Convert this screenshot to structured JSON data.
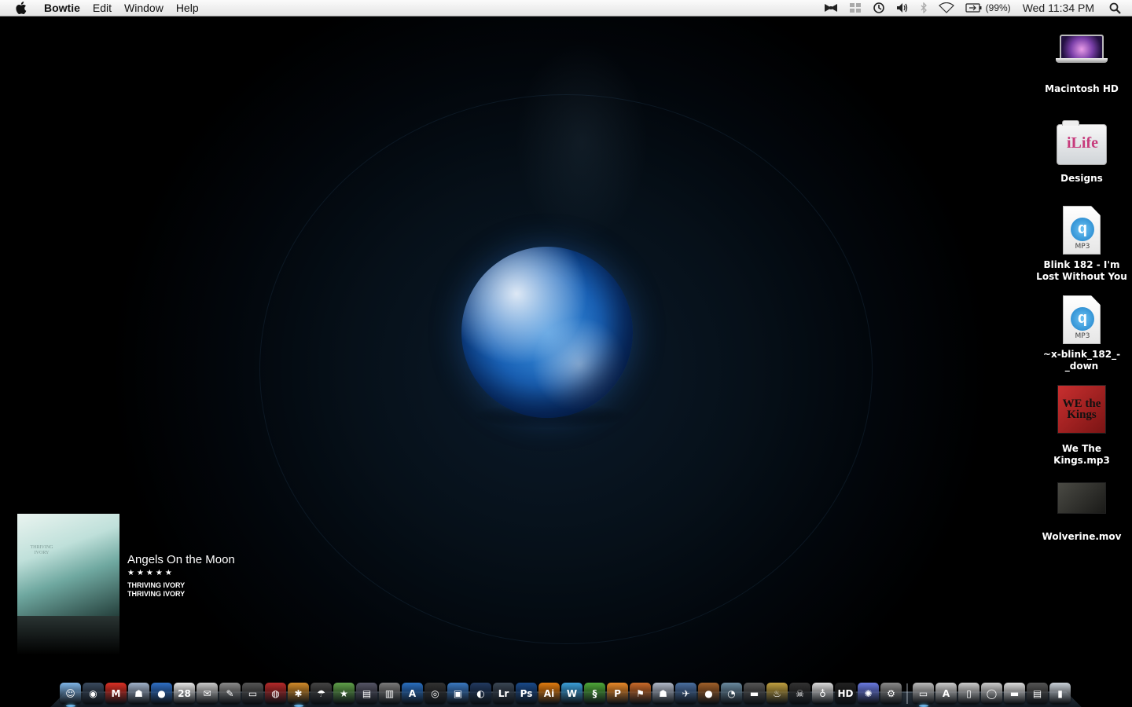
{
  "menubar": {
    "app_name": "Bowtie",
    "menus": [
      "Edit",
      "Window",
      "Help"
    ],
    "battery_percent": "(99%)",
    "clock": "Wed 11:34 PM"
  },
  "desktop_icons": [
    {
      "label": "Macintosh HD",
      "kind": "hard-drive"
    },
    {
      "label": "Designs",
      "kind": "folder",
      "badge": "iLife"
    },
    {
      "label": "Blink 182 - I'm Lost Without You",
      "kind": "mp3",
      "type_label": "MP3"
    },
    {
      "label": "~x-blink_182_-_down",
      "kind": "mp3",
      "type_label": "MP3"
    },
    {
      "label": "We The Kings.mp3",
      "kind": "album-art",
      "art_text": "WE the Kings"
    },
    {
      "label": "Wolverine.mov",
      "kind": "movie"
    }
  ],
  "now_playing": {
    "title": "Angels On the Moon",
    "rating_stars": "★★★★★",
    "artist": "THRIVING IVORY",
    "album": "THRIVING IVORY",
    "cover_text": "THRIVING IVORY"
  },
  "dock": {
    "apps": [
      {
        "name": "finder",
        "glyph": "☺",
        "color": "#7fb4e6"
      },
      {
        "name": "dashboard",
        "glyph": "◉",
        "color": "#3a4a5e"
      },
      {
        "name": "gmail",
        "glyph": "M",
        "color": "#d93025"
      },
      {
        "name": "robot",
        "glyph": "☗",
        "color": "#9fb0c8"
      },
      {
        "name": "firefox",
        "glyph": "●",
        "color": "#2f6fc4"
      },
      {
        "name": "ical",
        "glyph": "28",
        "color": "#e8e8e8"
      },
      {
        "name": "mail",
        "glyph": "✉",
        "color": "#c9c9c9"
      },
      {
        "name": "textedit",
        "glyph": "✎",
        "color": "#8a8a8a"
      },
      {
        "name": "display",
        "glyph": "▭",
        "color": "#555"
      },
      {
        "name": "record",
        "glyph": "◍",
        "color": "#b52a2a"
      },
      {
        "name": "clapper",
        "glyph": "✱",
        "color": "#d08a2a"
      },
      {
        "name": "umbrella",
        "glyph": "☂",
        "color": "#444"
      },
      {
        "name": "imovie",
        "glyph": "★",
        "color": "#5fa04a"
      },
      {
        "name": "film",
        "glyph": "▤",
        "color": "#556"
      },
      {
        "name": "books",
        "glyph": "▥",
        "color": "#7a7a7a"
      },
      {
        "name": "appstore",
        "glyph": "A",
        "color": "#2a6fc0"
      },
      {
        "name": "camera",
        "glyph": "◎",
        "color": "#333"
      },
      {
        "name": "preview",
        "glyph": "▣",
        "color": "#3a78c0"
      },
      {
        "name": "music",
        "glyph": "◐",
        "color": "#223a60"
      },
      {
        "name": "lightroom",
        "glyph": "Lr",
        "color": "#3a4654"
      },
      {
        "name": "photoshop",
        "glyph": "Ps",
        "color": "#1a4a8a"
      },
      {
        "name": "illustrator",
        "glyph": "Ai",
        "color": "#e07b10"
      },
      {
        "name": "wave",
        "glyph": "W",
        "color": "#3b9ed8"
      },
      {
        "name": "lizard",
        "glyph": "§",
        "color": "#4ea83a"
      },
      {
        "name": "paw",
        "glyph": "P",
        "color": "#e8892a"
      },
      {
        "name": "sign",
        "glyph": "⚑",
        "color": "#c86a2a"
      },
      {
        "name": "trooper",
        "glyph": "☗",
        "color": "#b0b8c8"
      },
      {
        "name": "plane",
        "glyph": "✈",
        "color": "#4a6fa0"
      },
      {
        "name": "coconut",
        "glyph": "●",
        "color": "#a0602a"
      },
      {
        "name": "time",
        "glyph": "◔",
        "color": "#6a8aa0"
      },
      {
        "name": "gun",
        "glyph": "▬",
        "color": "#555"
      },
      {
        "name": "fire",
        "glyph": "♨",
        "color": "#c0a040"
      },
      {
        "name": "pirate",
        "glyph": "☠",
        "color": "#333"
      },
      {
        "name": "bulb",
        "glyph": "♁",
        "color": "#ddd"
      },
      {
        "name": "hd",
        "glyph": "HD",
        "color": "#222"
      },
      {
        "name": "burst",
        "glyph": "✺",
        "color": "#6a7ae0"
      },
      {
        "name": "settings",
        "glyph": "⚙",
        "color": "#8a8a8a"
      }
    ],
    "stacks": [
      {
        "name": "stack-drive",
        "glyph": "▭",
        "color": "#bbb"
      },
      {
        "name": "stack-apps",
        "glyph": "A",
        "color": "#ccc"
      },
      {
        "name": "stack-docs",
        "glyph": "▯",
        "color": "#ccc"
      },
      {
        "name": "stack-downloads",
        "glyph": "◯",
        "color": "#ccc"
      },
      {
        "name": "stack-drive-2",
        "glyph": "▬",
        "color": "#ddd"
      },
      {
        "name": "stack-films",
        "glyph": "▤",
        "color": "#555"
      },
      {
        "name": "trash",
        "glyph": "▮",
        "color": "#c8d0d8"
      }
    ]
  }
}
